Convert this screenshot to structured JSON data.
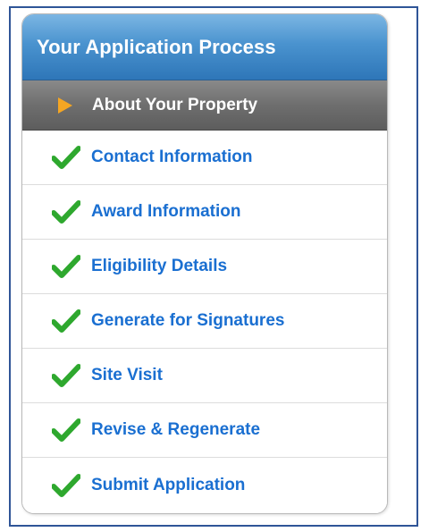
{
  "panel": {
    "title": "Your Application Process",
    "current_step": {
      "label": "About Your Property",
      "icon": "play-arrow-icon"
    },
    "steps": [
      {
        "label": "Contact Information",
        "icon": "check-icon",
        "status": "complete"
      },
      {
        "label": "Award Information",
        "icon": "check-icon",
        "status": "complete"
      },
      {
        "label": "Eligibility Details",
        "icon": "check-icon",
        "status": "complete"
      },
      {
        "label": "Generate for Signatures",
        "icon": "check-icon",
        "status": "complete"
      },
      {
        "label": "Site Visit",
        "icon": "check-icon",
        "status": "complete"
      },
      {
        "label": "Revise & Regenerate",
        "icon": "check-icon",
        "status": "complete"
      },
      {
        "label": "Submit Application",
        "icon": "check-icon",
        "status": "complete"
      }
    ]
  },
  "colors": {
    "header_blue": "#4a93cf",
    "current_step_gray": "#6e6e6e",
    "arrow_orange": "#f5a623",
    "check_green": "#2ea82e",
    "link_blue": "#1a6fd1"
  }
}
